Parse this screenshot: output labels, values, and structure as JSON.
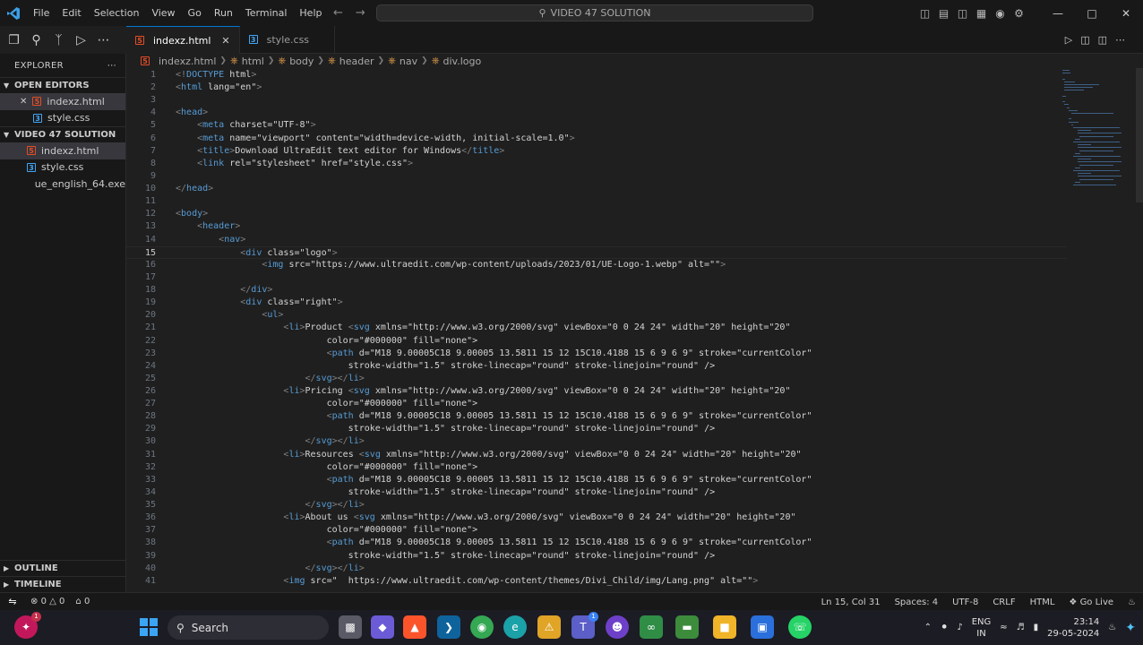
{
  "titlebar": {
    "menu": [
      "File",
      "Edit",
      "Selection",
      "View",
      "Go",
      "Run",
      "Terminal",
      "Help"
    ],
    "command_center": "VIDEO 47 SOLUTION"
  },
  "tabs": [
    {
      "label": "indexz.html",
      "type": "html",
      "active": true
    },
    {
      "label": "style.css",
      "type": "css",
      "active": false
    }
  ],
  "breadcrumb": [
    "indexz.html",
    "html",
    "body",
    "header",
    "nav",
    "div.logo"
  ],
  "sidebar": {
    "title": "EXPLORER",
    "open_editors": {
      "label": "OPEN EDITORS",
      "items": [
        {
          "label": "indexz.html",
          "type": "html"
        },
        {
          "label": "style.css",
          "type": "css"
        }
      ]
    },
    "workspace": {
      "label": "VIDEO 47 SOLUTION",
      "items": [
        {
          "label": "indexz.html",
          "type": "html"
        },
        {
          "label": "style.css",
          "type": "css"
        },
        {
          "label": "ue_english_64.exe",
          "type": "exe"
        }
      ]
    },
    "outline": "OUTLINE",
    "timeline": "TIMELINE"
  },
  "editor": {
    "current_line": 15,
    "lines": [
      "<!DOCTYPE html>",
      "<html lang=\"en\">",
      "",
      "<head>",
      "    <meta charset=\"UTF-8\">",
      "    <meta name=\"viewport\" content=\"width=device-width, initial-scale=1.0\">",
      "    <title>Download UltraEdit text editor for Windows</title>",
      "    <link rel=\"stylesheet\" href=\"style.css\">",
      "",
      "</head>",
      "",
      "<body>",
      "    <header>",
      "        <nav>",
      "            <div class=\"logo\">",
      "                <img src=\"https://www.ultraedit.com/wp-content/uploads/2023/01/UE-Logo-1.webp\" alt=\"\">",
      "",
      "            </div>",
      "            <div class=\"right\">",
      "                <ul>",
      "                    <li>Product <svg xmlns=\"http://www.w3.org/2000/svg\" viewBox=\"0 0 24 24\" width=\"20\" height=\"20\"",
      "                            color=\"#000000\" fill=\"none\">",
      "                            <path d=\"M18 9.00005C18 9.00005 13.5811 15 12 15C10.4188 15 6 9 6 9\" stroke=\"currentColor\"",
      "                                stroke-width=\"1.5\" stroke-linecap=\"round\" stroke-linejoin=\"round\" />",
      "                        </svg></li>",
      "                    <li>Pricing <svg xmlns=\"http://www.w3.org/2000/svg\" viewBox=\"0 0 24 24\" width=\"20\" height=\"20\"",
      "                            color=\"#000000\" fill=\"none\">",
      "                            <path d=\"M18 9.00005C18 9.00005 13.5811 15 12 15C10.4188 15 6 9 6 9\" stroke=\"currentColor\"",
      "                                stroke-width=\"1.5\" stroke-linecap=\"round\" stroke-linejoin=\"round\" />",
      "                        </svg></li>",
      "                    <li>Resources <svg xmlns=\"http://www.w3.org/2000/svg\" viewBox=\"0 0 24 24\" width=\"20\" height=\"20\"",
      "                            color=\"#000000\" fill=\"none\">",
      "                            <path d=\"M18 9.00005C18 9.00005 13.5811 15 12 15C10.4188 15 6 9 6 9\" stroke=\"currentColor\"",
      "                                stroke-width=\"1.5\" stroke-linecap=\"round\" stroke-linejoin=\"round\" />",
      "                        </svg></li>",
      "                    <li>About us <svg xmlns=\"http://www.w3.org/2000/svg\" viewBox=\"0 0 24 24\" width=\"20\" height=\"20\"",
      "                            color=\"#000000\" fill=\"none\">",
      "                            <path d=\"M18 9.00005C18 9.00005 13.5811 15 12 15C10.4188 15 6 9 6 9\" stroke=\"currentColor\"",
      "                                stroke-width=\"1.5\" stroke-linecap=\"round\" stroke-linejoin=\"round\" />",
      "                        </svg></li>",
      "                    <img src=\"  https://www.ultraedit.com/wp-content/themes/Divi_Child/img/Lang.png\" alt=\"\">"
    ]
  },
  "statusbar": {
    "errors": "0",
    "warnings": "0",
    "ports": "0",
    "position": "Ln 15, Col 31",
    "spaces": "Spaces: 4",
    "encoding": "UTF-8",
    "eol": "CRLF",
    "language": "HTML",
    "golive": "Go Live"
  },
  "taskbar": {
    "search": "Search",
    "lang_top": "ENG",
    "lang_bottom": "IN",
    "time": "23:14",
    "date": "29-05-2024"
  },
  "colors": {
    "accent": "#0078d4",
    "editor_bg": "#1f1f1f",
    "tag": "#569cd6",
    "attr": "#9cdcfe",
    "string": "#ce9178"
  }
}
